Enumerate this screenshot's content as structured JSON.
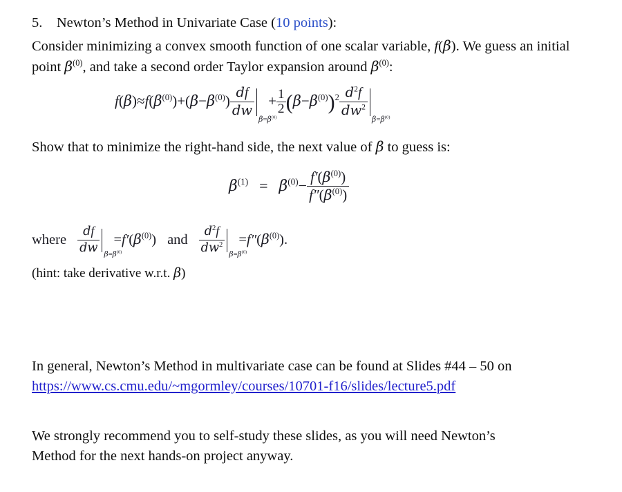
{
  "document": {
    "background_color": "#ffffff",
    "text_color": "#101010",
    "accent_blue": "#2B4FC8",
    "link_color": "#2222CC"
  },
  "question": {
    "number": "5.",
    "title": "Newton’s Method in Univariate Case (",
    "points": "10 points",
    "title_tail": "):"
  },
  "intro": {
    "line1_a": "Consider minimizing a convex smooth function of one scalar variable, ",
    "line1_f": "f",
    "line1_b": "(",
    "line1_beta": "β",
    "line1_c": "). We guess",
    "line2_a": "an initial point ",
    "line2_beta": "β",
    "line2_sup": "(0)",
    "line2_b": ", and take a second order Taylor expansion around ",
    "line2_beta2": "β",
    "line2_sup2": "(0)",
    "line2_c": ":"
  },
  "eq_taylor": {
    "lhs_f": "f",
    "lhs_open": "(",
    "lhs_beta": "β",
    "lhs_close": ")",
    "approx": "≈",
    "t1_f": "f",
    "t1_open": "(",
    "t1_beta": "β",
    "t1_sup": "(0)",
    "t1_close": ")",
    "plus1": "+",
    "t2_open": "(",
    "t2_beta": "β",
    "t2_minus": "−",
    "t2_beta0": "β",
    "t2_sup": "(0)",
    "t2_close": ")",
    "t2_frac_num_d": "d",
    "t2_frac_num_f": "f",
    "t2_frac_den_d": "d",
    "t2_frac_den_w": "w",
    "t2_eval_beta": "β",
    "t2_eval_eq": "=",
    "t2_eval_beta0": "β",
    "t2_eval_sup": "(0)",
    "plus2": "+",
    "half_num": "1",
    "half_den": "2",
    "t3_open": "(",
    "t3_beta": "β",
    "t3_minus": "−",
    "t3_beta0": "β",
    "t3_sup": "(0)",
    "t3_close": ")",
    "t3_power": "2",
    "t3_frac_num_d": "d",
    "t3_frac_num_exp": "2",
    "t3_frac_num_f": "f",
    "t3_frac_den_d": "d",
    "t3_frac_den_w": "w",
    "t3_frac_den_exp": "2",
    "t3_eval_beta": "β",
    "t3_eval_eq": "=",
    "t3_eval_beta0": "β",
    "t3_eval_sup": "(0)"
  },
  "show_line": {
    "a": "Show that to minimize the right-hand side, the next value of ",
    "beta": "β",
    "b": " to guess is:"
  },
  "eq_newton": {
    "lhs_beta": "β",
    "lhs_sup": "(1)",
    "equals": "=",
    "rhs_beta": "β",
    "rhs_sup": "(0)",
    "minus": "−",
    "num_f": "f",
    "num_prime": "′",
    "num_open": "(",
    "num_beta": "β",
    "num_sup": "(0)",
    "num_close": ")",
    "den_f": "f",
    "den_prime": "″",
    "den_open": "(",
    "den_beta": "β",
    "den_sup": "(0)",
    "den_close": ")"
  },
  "eq_where": {
    "where": "where",
    "f1_num_d": "d",
    "f1_num_f": "f",
    "f1_den_d": "d",
    "f1_den_w": "w",
    "f1_eval_beta": "β",
    "f1_eval_eq": "=",
    "f1_eval_beta0": "β",
    "f1_eval_sup": "(0)",
    "eq1": "=",
    "r1_f": "f",
    "r1_prime": "′",
    "r1_open": "(",
    "r1_beta": "β",
    "r1_sup": "(0)",
    "r1_close": ")",
    "and": "and",
    "f2_num_d": "d",
    "f2_num_exp": "2",
    "f2_num_f": "f",
    "f2_den_d": "d",
    "f2_den_w": "w",
    "f2_den_exp": "2",
    "f2_eval_beta": "β",
    "f2_eval_eq": "=",
    "f2_eval_beta0": "β",
    "f2_eval_sup": "(0)",
    "eq2": "=",
    "r2_f": "f",
    "r2_prime": "″",
    "r2_open": "(",
    "r2_beta": "β",
    "r2_sup": "(0)",
    "r2_close": ")",
    "period": "."
  },
  "hint": {
    "a": "(hint: take derivative w.r.t. ",
    "beta": "β",
    "b": ")"
  },
  "general_note": {
    "text": "In general, Newton’s Method in multivariate case can be found at Slides #44 – 50 on",
    "link": "https://www.cs.cmu.edu/~mgormley/courses/10701-f16/slides/lecture5.pdf"
  },
  "recommendation": {
    "line1": "We strongly recommend you to self-study these slides, as you will need Newton’s",
    "line2": "Method for the next hands-on project anyway."
  }
}
